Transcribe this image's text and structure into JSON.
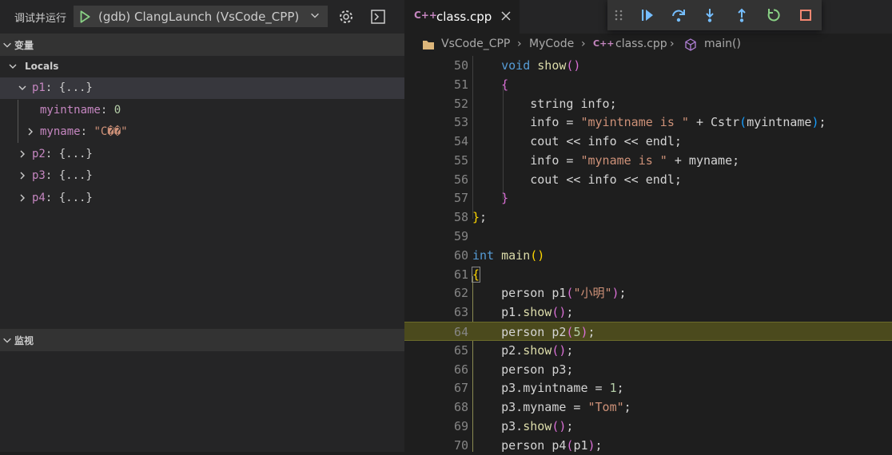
{
  "debug_toolbar": {
    "title": "调试并运行",
    "config": "(gdb) ClangLaunch (VsCode_CPP)"
  },
  "variables": {
    "header": "变量",
    "locals_label": "Locals",
    "items": [
      {
        "name": "p1",
        "value": "{...}"
      },
      {
        "name": "myintname",
        "value": "0"
      },
      {
        "name": "myname",
        "value": "\"C��\""
      },
      {
        "name": "p2",
        "value": "{...}"
      },
      {
        "name": "p3",
        "value": "{...}"
      },
      {
        "name": "p4",
        "value": "{...}"
      }
    ]
  },
  "watch": {
    "header": "监视"
  },
  "editor": {
    "tab_label": "class.cpp",
    "tab_icon": "C++",
    "breadcrumb": [
      "VsCode_CPP",
      "MyCode",
      "class.cpp",
      "main()"
    ],
    "current_line": 64,
    "lines": [
      {
        "num": "50",
        "text": "    void show()"
      },
      {
        "num": "51",
        "text": "    {"
      },
      {
        "num": "52",
        "text": "        string info;"
      },
      {
        "num": "53",
        "text": "        info = \"myintname is \" + Cstr(myintname);"
      },
      {
        "num": "54",
        "text": "        cout << info << endl;"
      },
      {
        "num": "55",
        "text": "        info = \"myname is \" + myname;"
      },
      {
        "num": "56",
        "text": "        cout << info << endl;"
      },
      {
        "num": "57",
        "text": "    }"
      },
      {
        "num": "58",
        "text": "};"
      },
      {
        "num": "59",
        "text": ""
      },
      {
        "num": "60",
        "text": "int main()"
      },
      {
        "num": "61",
        "text": "{"
      },
      {
        "num": "62",
        "text": "    person p1(\"小明\");"
      },
      {
        "num": "63",
        "text": "    p1.show();"
      },
      {
        "num": "64",
        "text": "    person p2(5);"
      },
      {
        "num": "65",
        "text": "    p2.show();"
      },
      {
        "num": "66",
        "text": "    person p3;"
      },
      {
        "num": "67",
        "text": "    p3.myintname = 1;"
      },
      {
        "num": "68",
        "text": "    p3.myname = \"Tom\";"
      },
      {
        "num": "69",
        "text": "    p3.show();"
      },
      {
        "num": "70",
        "text": "    person p4(p1);"
      }
    ]
  },
  "colors": {
    "accent": "#75beff",
    "play": "#89d185",
    "restart": "#89d185",
    "stop": "#f48771",
    "current_line": "#4b4a1d"
  }
}
